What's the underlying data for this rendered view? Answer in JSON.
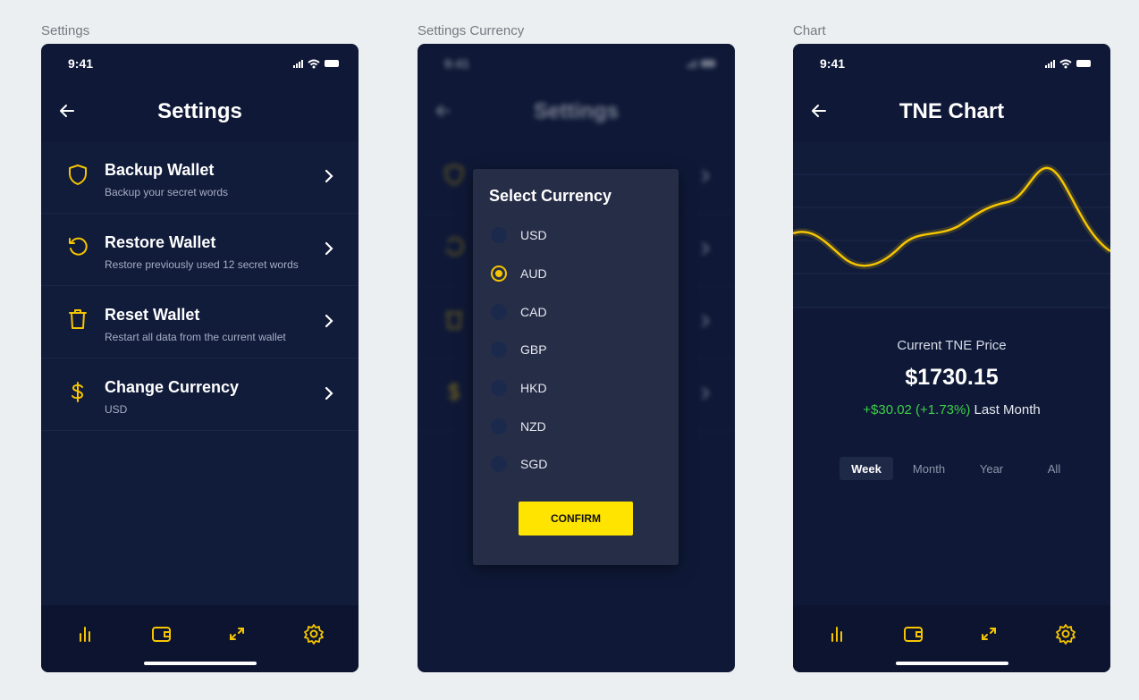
{
  "frames": [
    {
      "label": "Settings"
    },
    {
      "label": "Settings Currency"
    },
    {
      "label": "Chart"
    }
  ],
  "status": {
    "time": "9:41"
  },
  "settings": {
    "title": "Settings",
    "items": [
      {
        "title": "Backup Wallet",
        "subtitle": "Backup your secret words",
        "icon": "shield-icon"
      },
      {
        "title": "Restore Wallet",
        "subtitle": "Restore previously used 12 secret words",
        "icon": "restore-icon"
      },
      {
        "title": "Reset Wallet",
        "subtitle": "Restart all data from the current wallet",
        "icon": "trash-icon"
      },
      {
        "title": "Change Currency",
        "subtitle": "USD",
        "icon": "dollar-icon"
      }
    ]
  },
  "currency_dialog": {
    "title": "Select Currency",
    "options": [
      "USD",
      "AUD",
      "CAD",
      "GBP",
      "HKD",
      "NZD",
      "SGD"
    ],
    "selected": "AUD",
    "confirm_label": "CONFIRM"
  },
  "chart_screen": {
    "title": "TNE Chart",
    "price_label": "Current TNE Price",
    "price": "$1730.15",
    "change": "+$30.02 (+1.73%)",
    "period": "Last Month",
    "ranges": [
      "Week",
      "Month",
      "Year",
      "All"
    ],
    "active_range": "Week"
  },
  "tabbar": {
    "icons": [
      "chart-bars-icon",
      "wallet-icon",
      "transfer-icon",
      "settings-gear-icon"
    ]
  },
  "colors": {
    "background": "#0f1937",
    "accent": "#f6c500",
    "positive": "#3ecf4a",
    "confirm_button": "#ffe400"
  }
}
